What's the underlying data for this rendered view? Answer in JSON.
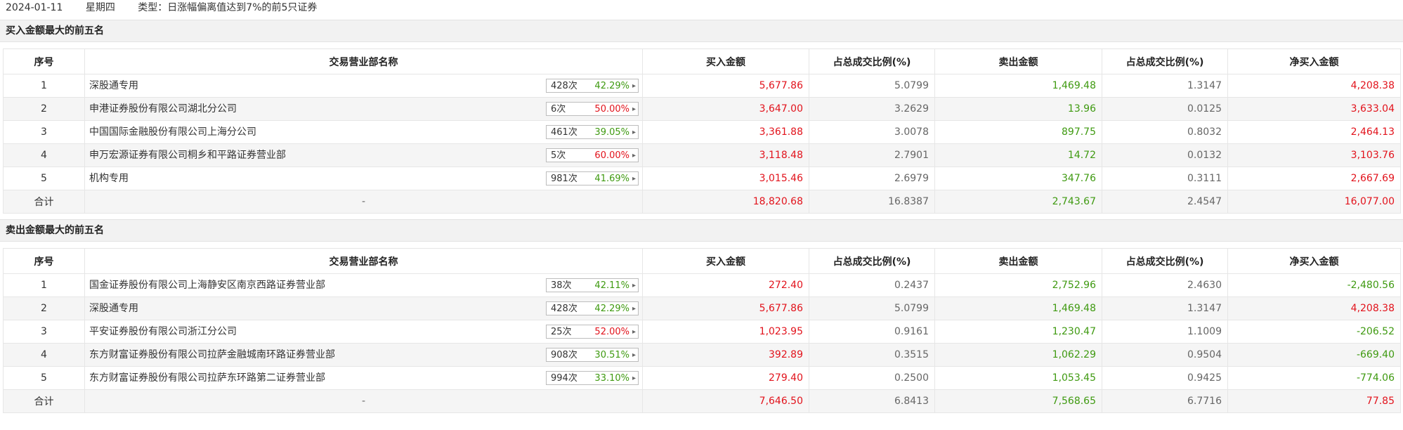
{
  "header": {
    "date": "2024-01-11",
    "weekday": "星期四",
    "type": "类型：日涨幅偏离值达到7%的前5只证券"
  },
  "columns": [
    "序号",
    "交易营业部名称",
    "买入金额",
    "占总成交比例(%)",
    "卖出金额",
    "占总成交比例(%)",
    "净买入金额"
  ],
  "buy": {
    "title": "买入金额最大的前五名",
    "rows": [
      {
        "no": "1",
        "name": "深股通专用",
        "count": "428次",
        "pct": "42.29%",
        "pct_color": "green",
        "buy": "5,677.86",
        "buy_ratio": "5.0799",
        "sell": "1,469.48",
        "sell_ratio": "1.3147",
        "net": "4,208.38",
        "net_color": "red"
      },
      {
        "no": "2",
        "name": "申港证券股份有限公司湖北分公司",
        "count": "6次",
        "pct": "50.00%",
        "pct_color": "red",
        "buy": "3,647.00",
        "buy_ratio": "3.2629",
        "sell": "13.96",
        "sell_ratio": "0.0125",
        "net": "3,633.04",
        "net_color": "red"
      },
      {
        "no": "3",
        "name": "中国国际金融股份有限公司上海分公司",
        "count": "461次",
        "pct": "39.05%",
        "pct_color": "green",
        "buy": "3,361.88",
        "buy_ratio": "3.0078",
        "sell": "897.75",
        "sell_ratio": "0.8032",
        "net": "2,464.13",
        "net_color": "red"
      },
      {
        "no": "4",
        "name": "申万宏源证券有限公司桐乡和平路证券营业部",
        "count": "5次",
        "pct": "60.00%",
        "pct_color": "red",
        "buy": "3,118.48",
        "buy_ratio": "2.7901",
        "sell": "14.72",
        "sell_ratio": "0.0132",
        "net": "3,103.76",
        "net_color": "red"
      },
      {
        "no": "5",
        "name": "机构专用",
        "count": "981次",
        "pct": "41.69%",
        "pct_color": "green",
        "buy": "3,015.46",
        "buy_ratio": "2.6979",
        "sell": "347.76",
        "sell_ratio": "0.3111",
        "net": "2,667.69",
        "net_color": "red"
      }
    ],
    "total": {
      "label": "合计",
      "name": "-",
      "buy": "18,820.68",
      "buy_ratio": "16.8387",
      "sell": "2,743.67",
      "sell_ratio": "2.4547",
      "net": "16,077.00",
      "net_color": "red"
    }
  },
  "sell": {
    "title": "卖出金额最大的前五名",
    "rows": [
      {
        "no": "1",
        "name": "国金证券股份有限公司上海静安区南京西路证券营业部",
        "count": "38次",
        "pct": "42.11%",
        "pct_color": "green",
        "buy": "272.40",
        "buy_ratio": "0.2437",
        "sell": "2,752.96",
        "sell_ratio": "2.4630",
        "net": "-2,480.56",
        "net_color": "green"
      },
      {
        "no": "2",
        "name": "深股通专用",
        "count": "428次",
        "pct": "42.29%",
        "pct_color": "green",
        "buy": "5,677.86",
        "buy_ratio": "5.0799",
        "sell": "1,469.48",
        "sell_ratio": "1.3147",
        "net": "4,208.38",
        "net_color": "red"
      },
      {
        "no": "3",
        "name": "平安证券股份有限公司浙江分公司",
        "count": "25次",
        "pct": "52.00%",
        "pct_color": "red",
        "buy": "1,023.95",
        "buy_ratio": "0.9161",
        "sell": "1,230.47",
        "sell_ratio": "1.1009",
        "net": "-206.52",
        "net_color": "green"
      },
      {
        "no": "4",
        "name": "东方财富证券股份有限公司拉萨金融城南环路证券营业部",
        "count": "908次",
        "pct": "30.51%",
        "pct_color": "green",
        "buy": "392.89",
        "buy_ratio": "0.3515",
        "sell": "1,062.29",
        "sell_ratio": "0.9504",
        "net": "-669.40",
        "net_color": "green"
      },
      {
        "no": "5",
        "name": "东方财富证券股份有限公司拉萨东环路第二证券营业部",
        "count": "994次",
        "pct": "33.10%",
        "pct_color": "green",
        "buy": "279.40",
        "buy_ratio": "0.2500",
        "sell": "1,053.45",
        "sell_ratio": "0.9425",
        "net": "-774.06",
        "net_color": "green"
      }
    ],
    "total": {
      "label": "合计",
      "name": "-",
      "buy": "7,646.50",
      "buy_ratio": "6.8413",
      "sell": "7,568.65",
      "sell_ratio": "6.7716",
      "net": "77.85",
      "net_color": "red"
    }
  },
  "colors": {
    "red": "#e2131c",
    "green": "#3f9a11"
  }
}
